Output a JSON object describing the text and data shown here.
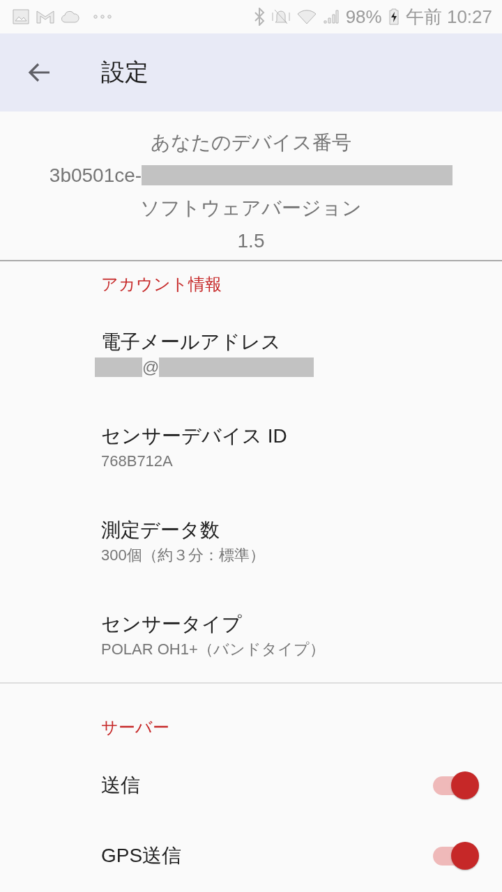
{
  "status_bar": {
    "battery": "98%",
    "time": "午前 10:27"
  },
  "app_bar": {
    "title": "設定"
  },
  "device_info": {
    "device_number_label": "あなたのデバイス番号",
    "device_number": [
      {
        "kind": "text",
        "text": "3b0501ce-"
      },
      {
        "kind": "redacted"
      }
    ],
    "version_label": "ソフトウェアバージョン",
    "version": "1.5"
  },
  "sections": [
    {
      "header": "アカウント情報",
      "items": [
        {
          "kind": "detail",
          "title": "電子メールアドレス",
          "value_segments": [
            {
              "kind": "redacted"
            },
            {
              "kind": "text",
              "text": "@"
            },
            {
              "kind": "redacted"
            }
          ]
        },
        {
          "kind": "detail",
          "title": "センサーデバイス ID",
          "value": "768B712A"
        },
        {
          "kind": "detail",
          "title": "測定データ数",
          "value": "300個（約３分：標準）"
        },
        {
          "kind": "detail",
          "title": "センサータイプ",
          "value": "POLAR OH1+（バンドタイプ）"
        }
      ]
    },
    {
      "header": "サーバー",
      "items": [
        {
          "kind": "switch",
          "title": "送信",
          "on": true
        },
        {
          "kind": "switch",
          "title": "GPS送信",
          "on": true
        }
      ]
    }
  ]
}
